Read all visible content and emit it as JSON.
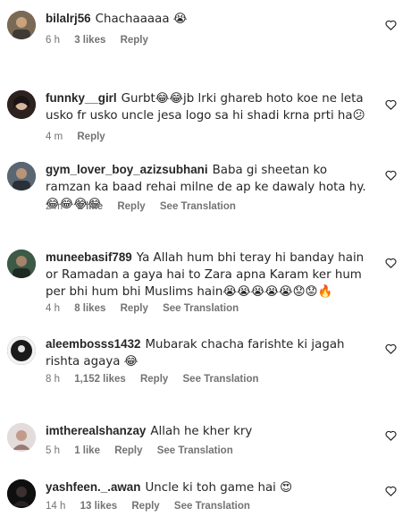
{
  "comments": [
    {
      "user": "bilalrj56",
      "text": "Chachaaaaa 😭",
      "time": "6 h",
      "likes": "3 likes",
      "reply": "Reply",
      "translation": ""
    },
    {
      "user": "funnky__girl",
      "text": "Gurbt😂😂jb lrki ghareb hoto koe ne leta usko fr usko uncle jesa logo sa hi shadi krna prti ha😕",
      "time": "4 m",
      "likes": "",
      "reply": "Reply",
      "translation": ""
    },
    {
      "user": "gym_lover_boy_azizsubhani",
      "text": "Baba gi sheetan ko ramzan ka baad rehai milne de ap ke dawaly hota hy. 😂😂😂😂",
      "time": "2 m",
      "likes": "1 like",
      "reply": "Reply",
      "translation": "See Translation"
    },
    {
      "user": "muneebasif789",
      "text": "Ya Allah hum bhi teray hi banday hain or Ramadan a gaya hai to Zara apna Karam ker hum per bhi hum bhi Muslims hain😭😭😭😭😭😟😟🔥",
      "time": "4 h",
      "likes": "8 likes",
      "reply": "Reply",
      "translation": "See Translation"
    },
    {
      "user": "aleembosss1432",
      "text": "Mubarak chacha farishte ki jagah rishta agaya 😂",
      "time": "8 h",
      "likes": "1,152 likes",
      "reply": "Reply",
      "translation": "See Translation"
    },
    {
      "user": "imtherealshanzay",
      "text": "Allah he kher kry",
      "time": "5 h",
      "likes": "1 like",
      "reply": "Reply",
      "translation": "See Translation"
    },
    {
      "user": "yashfeen._.awan",
      "text": "Uncle ki toh game hai 😍",
      "time": "14 h",
      "likes": "13 likes",
      "reply": "Reply",
      "translation": "See Translation"
    }
  ],
  "icons": {
    "like": "heart-outline-icon"
  },
  "colors": {
    "meta": "#737373",
    "text": "#262626"
  }
}
